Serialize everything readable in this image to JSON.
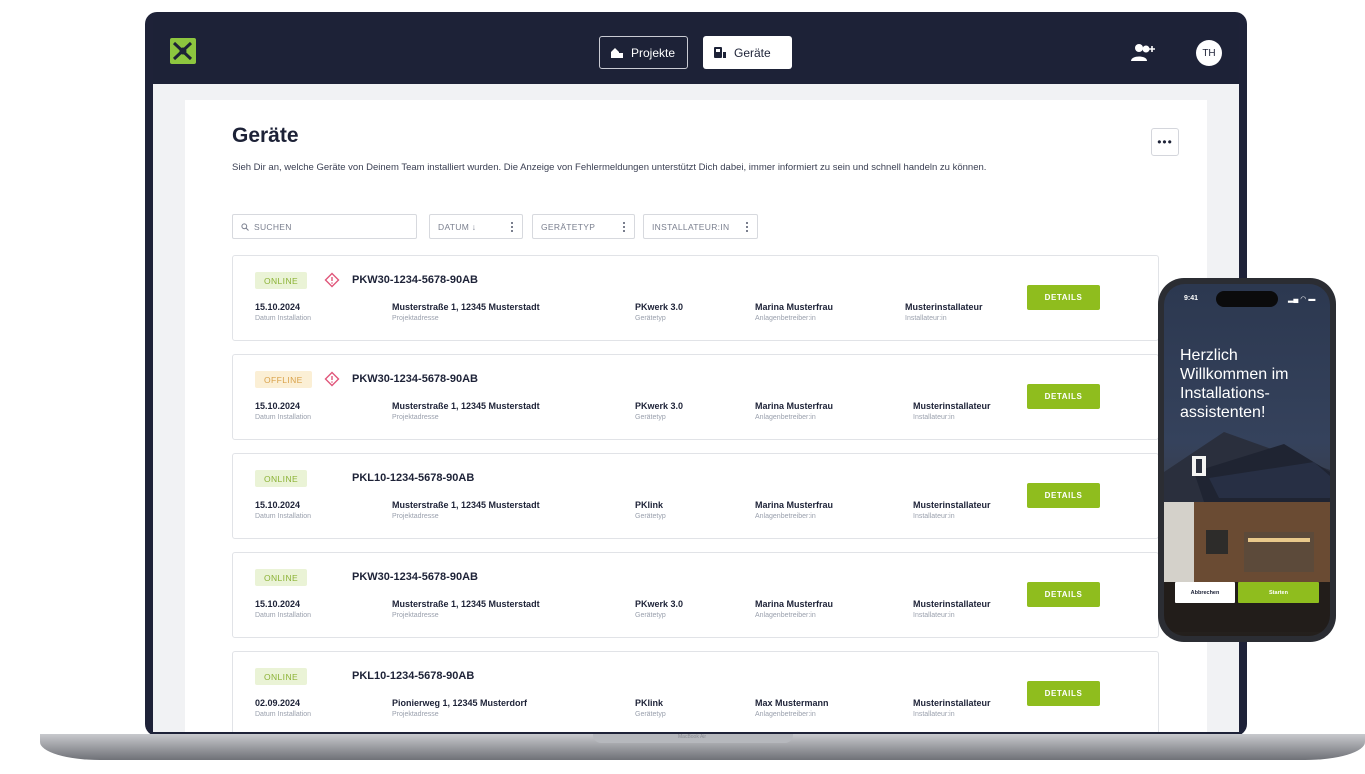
{
  "nav": {
    "projekte_label": "Projekte",
    "geraete_label": "Geräte",
    "avatar_initials": "TH"
  },
  "page": {
    "title": "Geräte",
    "description": "Sieh Dir an, welche Geräte von Deinem Team installiert wurden. Die Anzeige von Fehlermeldungen unterstützt Dich dabei, immer informiert zu sein und schnell handeln zu können.",
    "more_label": "•••"
  },
  "filters": {
    "search_placeholder": "SUCHEN",
    "datum": "DATUM ↓",
    "geraetetyp": "GERÄTETYP",
    "installateur": "INSTALLATEUR:IN"
  },
  "labels": {
    "date": "Datum Installation",
    "address": "Projektadresse",
    "type": "Gerätetyp",
    "operator": "Anlagenbetreiber:in",
    "installer": "Installateur:in",
    "details": "DETAILS"
  },
  "devices": [
    {
      "status": "ONLINE",
      "warning": true,
      "id": "PKW30-1234-5678-90AB",
      "date": "15.10.2024",
      "address": "Musterstraße 1, 12345 Musterstadt",
      "type": "PKwerk 3.0",
      "operator": "Marina Musterfrau",
      "installer": "Musterinstallateur"
    },
    {
      "status": "OFFLINE",
      "warning": true,
      "id": "PKW30-1234-5678-90AB",
      "date": "15.10.2024",
      "address": "Musterstraße 1, 12345 Musterstadt",
      "type": "PKwerk 3.0",
      "operator": "Marina Musterfrau",
      "installer": "Musterinstallateur"
    },
    {
      "status": "ONLINE",
      "warning": false,
      "id": "PKL10-1234-5678-90AB",
      "date": "15.10.2024",
      "address": "Musterstraße 1, 12345 Musterstadt",
      "type": "PKlink",
      "operator": "Marina Musterfrau",
      "installer": "Musterinstallateur"
    },
    {
      "status": "ONLINE",
      "warning": false,
      "id": "PKW30-1234-5678-90AB",
      "date": "15.10.2024",
      "address": "Musterstraße 1, 12345 Musterstadt",
      "type": "PKwerk 3.0",
      "operator": "Marina Musterfrau",
      "installer": "Musterinstallateur"
    },
    {
      "status": "ONLINE",
      "warning": false,
      "id": "PKL10-1234-5678-90AB",
      "date": "02.09.2024",
      "address": "Pionierweg 1, 12345 Musterdorf",
      "type": "PKlink",
      "operator": "Max Mustermann",
      "installer": "Musterinstallateur"
    }
  ],
  "phone": {
    "time": "9:41",
    "status_icons": "▂▄ ◠ ▬",
    "title": "Herzlich Willkommen im Installations-assistenten!",
    "cancel_label": "Abbrechen",
    "start_label": "Starten"
  },
  "device_label": "MacBook Air",
  "colors": {
    "navy": "#1d2237",
    "accent_green": "#8fbd1e",
    "online_badge_bg": "#eaf3d6",
    "offline_badge_bg": "#fbefd5",
    "warning_pink": "#e0567a"
  }
}
